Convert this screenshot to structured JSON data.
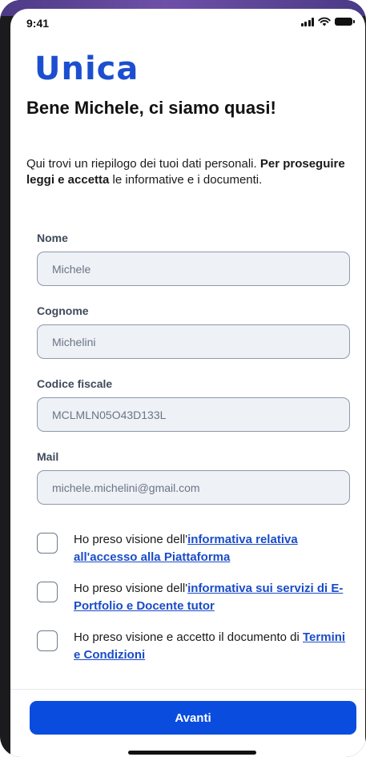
{
  "status_bar": {
    "time": "9:41"
  },
  "brand": {
    "logo_text": "Unica",
    "color": "#1c4fcf"
  },
  "header": {
    "title": "Bene Michele, ci siamo quasi!",
    "intro_lead": "Qui trovi un riepilogo dei tuoi dati personali. ",
    "intro_bold": "Per proseguire leggi e accetta",
    "intro_tail": " le informative e i documenti."
  },
  "fields": [
    {
      "label": "Nome",
      "value": "Michele"
    },
    {
      "label": "Cognome",
      "value": "Michelini"
    },
    {
      "label": "Codice fiscale",
      "value": "MCLMLN05O43D133L"
    },
    {
      "label": "Mail",
      "value": "michele.michelini@gmail.com"
    }
  ],
  "consents": [
    {
      "prefix": "Ho preso visione dell'",
      "link": "informativa relativa all'accesso alla Piattaforma",
      "checked": false
    },
    {
      "prefix": "Ho preso visione dell'",
      "link": "informativa sui servizi di E-Portfolio e Docente tutor",
      "checked": false
    },
    {
      "prefix": "Ho preso visione e accetto il documento di ",
      "link": "Termini e Condizioni",
      "checked": false
    }
  ],
  "footer": {
    "cta_label": "Avanti",
    "cta_color": "#0a4dde"
  },
  "icons": [
    "signal-icon",
    "wifi-icon",
    "battery-icon"
  ]
}
